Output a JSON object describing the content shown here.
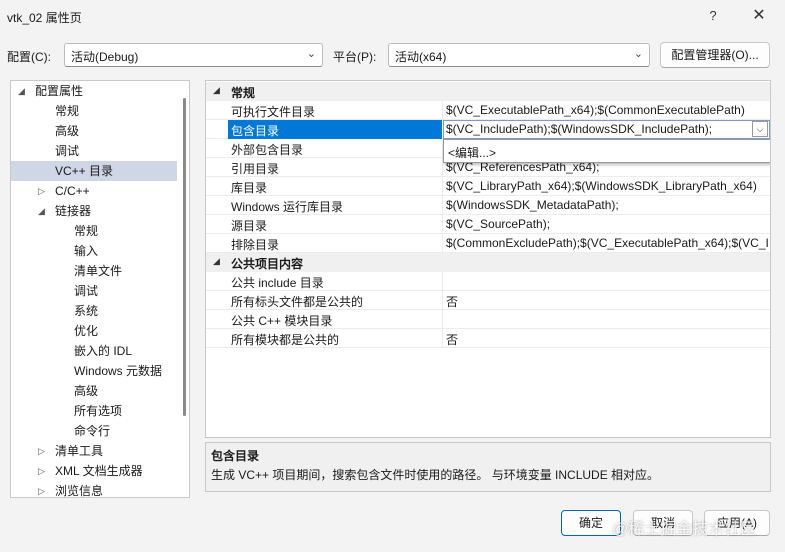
{
  "window": {
    "title": "vtk_02 属性页",
    "help_glyph": "?",
    "close_glyph": "✕"
  },
  "config": {
    "config_label": "配置(C):",
    "config_value": "活动(Debug)",
    "platform_label": "平台(P):",
    "platform_value": "活动(x64)",
    "manager_button": "配置管理器(O)..."
  },
  "tree": {
    "items": [
      {
        "label": "配置属性",
        "twisty": "◢"
      },
      {
        "label": "常规"
      },
      {
        "label": "高级"
      },
      {
        "label": "调试"
      },
      {
        "label": "VC++ 目录"
      },
      {
        "label": "C/C++",
        "twisty": "▷"
      },
      {
        "label": "链接器",
        "twisty": "◢"
      },
      {
        "label": "常规"
      },
      {
        "label": "输入"
      },
      {
        "label": "清单文件"
      },
      {
        "label": "调试"
      },
      {
        "label": "系统"
      },
      {
        "label": "优化"
      },
      {
        "label": "嵌入的 IDL"
      },
      {
        "label": "Windows 元数据"
      },
      {
        "label": "高级"
      },
      {
        "label": "所有选项"
      },
      {
        "label": "命令行"
      },
      {
        "label": "清单工具",
        "twisty": "▷"
      },
      {
        "label": "XML 文档生成器",
        "twisty": "▷"
      },
      {
        "label": "浏览信息",
        "twisty": "▷"
      }
    ]
  },
  "grid": {
    "cat1": "常规",
    "cat2": "公共项目内容",
    "rows": [
      {
        "name": "可执行文件目录",
        "value": "$(VC_ExecutablePath_x64);$(CommonExecutablePath)"
      },
      {
        "name": "包含目录",
        "value": "$(VC_IncludePath);$(WindowsSDK_IncludePath);"
      },
      {
        "name": "外部包含目录",
        "value": ""
      },
      {
        "name": "引用目录",
        "value": "$(VC_ReferencesPath_x64);"
      },
      {
        "name": "库目录",
        "value": "$(VC_LibraryPath_x64);$(WindowsSDK_LibraryPath_x64)"
      },
      {
        "name": "Windows 运行库目录",
        "value": "$(WindowsSDK_MetadataPath);"
      },
      {
        "name": "源目录",
        "value": "$(VC_SourcePath);"
      },
      {
        "name": "排除目录",
        "value": "$(CommonExcludePath);$(VC_ExecutablePath_x64);$(VC_I"
      },
      {
        "name": "公共 include 目录",
        "value": ""
      },
      {
        "name": "所有标头文件都是公共的",
        "value": "否"
      },
      {
        "name": "公共 C++ 模块目录",
        "value": ""
      },
      {
        "name": "所有模块都是公共的",
        "value": "否"
      }
    ],
    "dropdown_item": "<编辑...>",
    "dropdown_arrow": "⌵"
  },
  "description": {
    "title": "包含目录",
    "text": "生成 VC++ 项目期间，搜索包含文件时使用的路径。 与环境变量 INCLUDE 相对应。"
  },
  "buttons": {
    "ok": "确定",
    "cancel": "取消",
    "apply": "应用(A)"
  },
  "watermark": "@稀土掘金技术社区"
}
